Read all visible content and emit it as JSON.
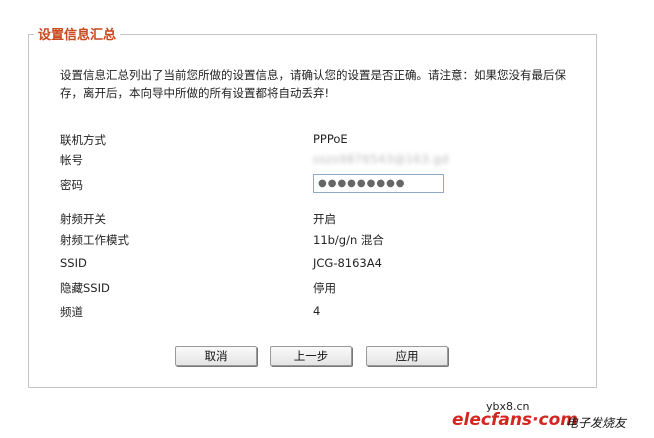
{
  "panel": {
    "title": "设置信息汇总",
    "intro": "设置信息汇总列出了当前您所做的设置信息，请确认您的设置是否正确。请注意：如果您没有最后保存，离开后，本向导中所做的所有设置都将自动丢弃!"
  },
  "fields": {
    "connection_label": "联机方式",
    "connection_value": "PPPoE",
    "account_label": "帐号",
    "account_value": "sszs9876543@163.gd",
    "password_label": "密码",
    "password_value": "●●●●●●●●●",
    "radio_switch_label": "射频开关",
    "radio_switch_value": "开启",
    "radio_mode_label": "射频工作模式",
    "radio_mode_value": "11b/g/n 混合",
    "ssid_label": "SSID",
    "ssid_value": "JCG-8163A4",
    "hide_ssid_label": "隐藏SSID",
    "hide_ssid_value": "停用",
    "channel_label": "频道",
    "channel_value": "4"
  },
  "buttons": {
    "cancel": "取消",
    "previous": "上一步",
    "apply": "应用"
  },
  "watermark": {
    "url": "ybx8.cn",
    "logo": "elecfans",
    "logo_suffix": "·com",
    "cn_text": "电子发烧友"
  },
  "colors": {
    "title": "#c8481d",
    "watermark": "#d3261f"
  }
}
